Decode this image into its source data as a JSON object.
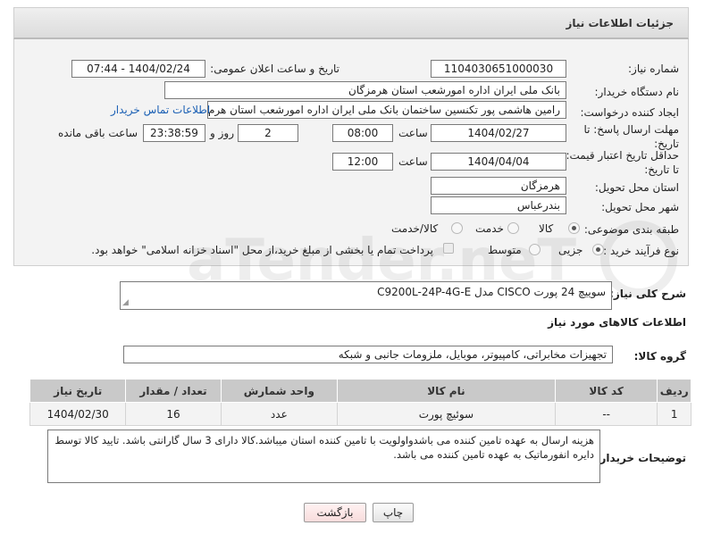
{
  "header": {
    "title": "جزئیات اطلاعات نیاز"
  },
  "fields": {
    "need_number_label": "شماره نیاز:",
    "need_number": "1104030651000030",
    "announce_label": "تاریخ و ساعت اعلان عمومی:",
    "announce_value": "1404/02/24 - 07:44",
    "buyer_label": "نام دستگاه خریدار:",
    "buyer_value": "بانک ملی ایران اداره امورشعب استان هرمزگان",
    "creator_label": "ایجاد کننده درخواست:",
    "creator_value": "رامین هاشمی پور تکنسین ساختمان بانک ملی ایران اداره امورشعب استان هرم",
    "contact_link": "اطلاعات تماس خریدار",
    "deadline_label": "مهلت ارسال پاسخ: تا تاریخ:",
    "deadline_date": "1404/02/27",
    "time_label": "ساعت",
    "deadline_time": "08:00",
    "days_value": "2",
    "days_label": "روز و",
    "remaining_time": "23:38:59",
    "remaining_label": "ساعت باقی مانده",
    "validity_label": "حداقل تاریخ اعتبار قیمت: تا تاریخ:",
    "validity_date": "1404/04/04",
    "validity_time": "12:00",
    "province_label": "استان محل تحویل:",
    "province_value": "هرمزگان",
    "city_label": "شهر محل تحویل:",
    "city_value": "بندرعباس",
    "category_label": "طبقه بندی موضوعی:",
    "category_options": [
      "کالا",
      "خدمت",
      "کالا/خدمت"
    ],
    "category_selected": "کالا",
    "process_label": "نوع فرآیند خرید :",
    "process_options": [
      "جزیی",
      "متوسط"
    ],
    "process_selected": "جزیی",
    "payment_note": "پرداخت تمام یا بخشی از مبلغ خرید،از محل \"اسناد خزانه اسلامی\" خواهد بود."
  },
  "general_desc": {
    "label": "شرح کلی نیاز:",
    "value": "سوییچ 24 پورت CISCO مدل C9200L-24P-4G-E"
  },
  "items_section": {
    "title": "اطلاعات کالاهای مورد نیاز",
    "group_label": "گروه کالا:",
    "group_value": "تجهیزات مخابراتی، کامپیوتر، موبایل، ملزومات جانبی و شبکه",
    "columns": [
      "ردیف",
      "کد کالا",
      "نام کالا",
      "واحد شمارش",
      "تعداد / مقدار",
      "تاریخ نیاز"
    ],
    "rows": [
      {
        "index": "1",
        "code": "--",
        "name": "سوئیچ پورت",
        "unit": "عدد",
        "qty": "16",
        "date": "1404/02/30"
      }
    ]
  },
  "buyer_notes": {
    "label": "توضیحات خریدار:",
    "value": "هزینه ارسال به عهده تامین کننده می باشدواولویت با تامین کننده استان میباشد.کالا دارای 3 سال گارانتی باشد. تایید کالا توسط دایره انفورماتیک به عهده تامین کننده می باشد."
  },
  "buttons": {
    "print": "چاپ",
    "back": "بازگشت"
  },
  "watermark": {
    "text": "AriaTender.neT"
  },
  "colors": {
    "link": "#1a5fb4",
    "panel_bg": "#f3f3f3",
    "table_header": "#c9c9c9",
    "back_button_bg": "#fde8e8"
  }
}
